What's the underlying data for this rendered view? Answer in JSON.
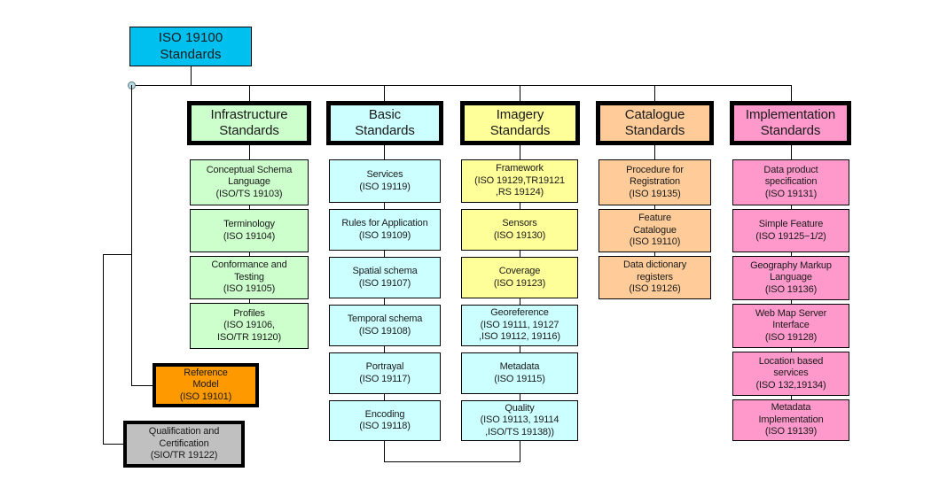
{
  "diagram": {
    "title": "ISO 19100 Standards hierarchy",
    "root": {
      "id": "root",
      "label": "ISO 19100\nStandards",
      "color": "#00c0f0"
    },
    "colors": {
      "root_blue": "#00c0f0",
      "infrastructure_green": "#ccffcc",
      "basic_cyan": "#ccffff",
      "imagery_yellow": "#ffff99",
      "catalogue_orange": "#ffcc99",
      "implementation_pink": "#ff99cc",
      "reference_orange": "#ff9900",
      "qualification_gray": "#c0c0c0",
      "outline_black": "#000000"
    },
    "columns": [
      {
        "id": "infrastructure",
        "header": "Infrastructure\nStandards",
        "header_color": "#ccffcc",
        "items": [
          {
            "label": "Conceptual Schema\nLanguage\n(ISO/TS 19103)",
            "color": "#ccffcc"
          },
          {
            "label": "Terminology\n(ISO 19104)",
            "color": "#ccffcc"
          },
          {
            "label": "Conformance and\nTesting\n(ISO 19105)",
            "color": "#ccffcc"
          },
          {
            "label": "Profiles\n(ISO 19106,\nISO/TR 19120)",
            "color": "#ccffcc"
          }
        ]
      },
      {
        "id": "basic",
        "header": "Basic\nStandards",
        "header_color": "#ccffff",
        "items": [
          {
            "label": "Services\n(ISO 19119)",
            "color": "#ccffff"
          },
          {
            "label": "Rules for Application\n(ISO 19109)",
            "color": "#ccffff"
          },
          {
            "label": "Spatial schema\n(ISO 19107)",
            "color": "#ccffff"
          },
          {
            "label": "Temporal schema\n(ISO 19108)",
            "color": "#ccffff"
          },
          {
            "label": "Portrayal\n(ISO 19117)",
            "color": "#ccffff"
          },
          {
            "label": "Encoding\n(ISO 19118)",
            "color": "#ccffff"
          }
        ]
      },
      {
        "id": "imagery",
        "header": "Imagery\nStandards",
        "header_color": "#ffff99",
        "items": [
          {
            "label": "Framework\n(ISO 19129,TR19121\n,RS 19124)",
            "color": "#ffff99"
          },
          {
            "label": "Sensors\n(ISO 19130)",
            "color": "#ffff99"
          },
          {
            "label": "Coverage\n(ISO 19123)",
            "color": "#ffff99"
          },
          {
            "label": "Georeference\n(ISO 19111, 19127\n,ISO 19112, 19116)",
            "color": "#ccffff"
          },
          {
            "label": "Metadata\n(ISO 19115)",
            "color": "#ccffff"
          },
          {
            "label": "Quality\n(ISO 19113, 19114\n,ISO/TS 19138))",
            "color": "#ccffff"
          }
        ]
      },
      {
        "id": "catalogue",
        "header": "Catalogue\nStandards",
        "header_color": "#ffcc99",
        "items": [
          {
            "label": "Procedure for\nRegistration\n(ISO 19135)",
            "color": "#ffcc99"
          },
          {
            "label": "Feature\nCatalogue\n(ISO 19110)",
            "color": "#ffcc99"
          },
          {
            "label": "Data dictionary\nregisters\n(ISO 19126)",
            "color": "#ffcc99"
          }
        ]
      },
      {
        "id": "implementation",
        "header": "Implementation\nStandards",
        "header_color": "#ff99cc",
        "items": [
          {
            "label": "Data product\nspecification\n(ISO 19131)",
            "color": "#ff99cc"
          },
          {
            "label": "Simple Feature\n(ISO 19125−1/2)",
            "color": "#ff99cc"
          },
          {
            "label": "Geography Markup\nLanguage\n(ISO 19136)",
            "color": "#ff99cc"
          },
          {
            "label": "Web Map Server\nInterface\n(ISO 19128)",
            "color": "#ff99cc"
          },
          {
            "label": "Location based\nservices\n(ISO 132,19134)",
            "color": "#ff99cc"
          },
          {
            "label": "Metadata\nImplementation\n(ISO 19139)",
            "color": "#ff99cc"
          }
        ]
      }
    ],
    "side_nodes": [
      {
        "id": "reference-model",
        "label": "Reference\nModel\n(ISO 19101)",
        "color": "#ff9900"
      },
      {
        "id": "qualification-certification",
        "label": "Qualification and\nCertification\n(SIO/TR 19122)",
        "color": "#c0c0c0"
      }
    ]
  }
}
